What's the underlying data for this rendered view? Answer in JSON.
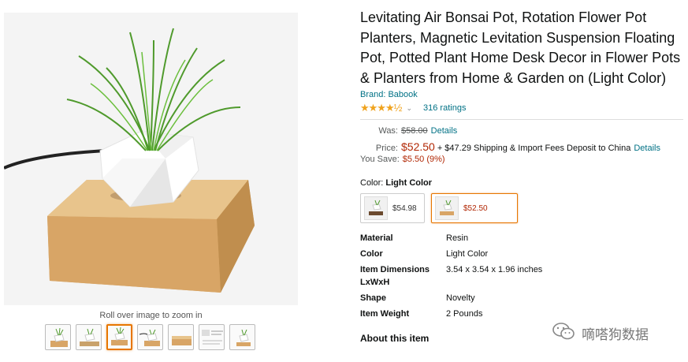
{
  "gallery": {
    "zoom_hint": "Roll over image to zoom in",
    "thumbnail_count": 7,
    "selected_thumbnail": 3
  },
  "product": {
    "title": "Levitating Air Bonsai Pot, Rotation Flower Pot Planters, Magnetic Levitation Suspension Floating Pot, Potted Plant Home Desk Decor in Flower Pots & Planters from Home & Garden on (Light Color)",
    "brand": "Brand: Babook",
    "stars": "★★★★½",
    "rating_value": 4.5,
    "ratings_count": "316 ratings"
  },
  "pricing": {
    "was_label": "Was:",
    "was_price": "$58.00",
    "details_label": "Details",
    "price_label": "Price:",
    "price": "$52.50",
    "shipping": "+ $47.29 Shipping & Import Fees Deposit to China",
    "shipping_details": "Details",
    "save_label": "You Save:",
    "save_amount": "$5.50 (9%)"
  },
  "color": {
    "label": "Color:",
    "selected": "Light Color",
    "options": [
      {
        "price": "$54.98"
      },
      {
        "price": "$52.50"
      }
    ]
  },
  "specs": [
    {
      "key": "Material",
      "value": "Resin"
    },
    {
      "key": "Color",
      "value": "Light Color"
    },
    {
      "key": "Item Dimensions LxWxH",
      "value": "3.54 x 3.54 x 1.96 inches"
    },
    {
      "key": "Shape",
      "value": "Novelty"
    },
    {
      "key": "Item Weight",
      "value": "2 Pounds"
    }
  ],
  "about_heading": "About this item",
  "watermark": "嘀嗒狗数据",
  "colors": {
    "link": "#007185",
    "price_red": "#b12704",
    "star": "#f0a31e",
    "selected_border": "#e77600"
  }
}
